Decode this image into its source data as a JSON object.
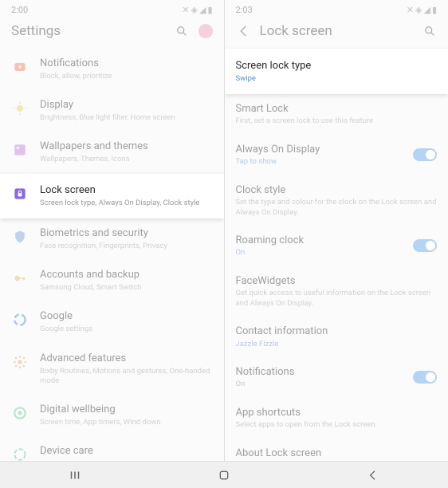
{
  "left": {
    "time": "2:00",
    "title": "Settings",
    "items": [
      {
        "icon": "notifications",
        "color": "#e87a5a",
        "title": "Notifications",
        "sub": "Block, allow, prioritize"
      },
      {
        "icon": "display",
        "color": "#e8c85a",
        "title": "Display",
        "sub": "Brightness, Blue light filter, Home screen"
      },
      {
        "icon": "wallpaper",
        "color": "#b87ad8",
        "title": "Wallpapers and themes",
        "sub": "Wallpapers, Themes, Icons"
      },
      {
        "icon": "lock",
        "color": "#8a6ae0",
        "title": "Lock screen",
        "sub": "Screen lock type, Always On Display, Clock style",
        "highlighted": true
      },
      {
        "icon": "shield",
        "color": "#6aa0d8",
        "title": "Biometrics and security",
        "sub": "Face recognition, Fingerprints, Privacy"
      },
      {
        "icon": "key",
        "color": "#d8b86a",
        "title": "Accounts and backup",
        "sub": "Samsung Cloud, Smart Switch"
      },
      {
        "icon": "google",
        "color": "#4285f4",
        "title": "Google",
        "sub": "Google settings"
      },
      {
        "icon": "advanced",
        "color": "#e8a05a",
        "title": "Advanced features",
        "sub": "Bixby Routines, Motions and gestures, One-handed mode"
      },
      {
        "icon": "wellbeing",
        "color": "#5ac88a",
        "title": "Digital wellbeing",
        "sub": "Screen time, App timers, Wind down"
      },
      {
        "icon": "device",
        "color": "#5ac8a0",
        "title": "Device care",
        "sub": ""
      }
    ]
  },
  "right": {
    "time": "2:03",
    "title": "Lock screen",
    "items": [
      {
        "title": "Screen lock type",
        "sub": "Swipe",
        "subBlue": true,
        "highlighted": true
      },
      {
        "title": "Smart Lock",
        "sub": "First, set a screen lock to use this feature"
      },
      {
        "title": "Always On Display",
        "sub": "Tap to show",
        "subBlue": true,
        "toggle": true
      },
      {
        "title": "Clock style",
        "sub": "Set the type and colour for the clock on the Lock screen and Always On Display."
      },
      {
        "title": "Roaming clock",
        "sub": "On",
        "subBlue": true,
        "toggle": true
      },
      {
        "title": "FaceWidgets",
        "sub": "Get quick access to useful information on the Lock screen and Always On Display."
      },
      {
        "title": "Contact information",
        "sub": "Jazzle Fizzle",
        "subBlue": true
      },
      {
        "title": "Notifications",
        "sub": "On",
        "subBlue": true,
        "toggle": true
      },
      {
        "title": "App shortcuts",
        "sub": "Select apps to open from the Lock screen."
      },
      {
        "title": "About Lock screen",
        "sub": ""
      }
    ]
  }
}
